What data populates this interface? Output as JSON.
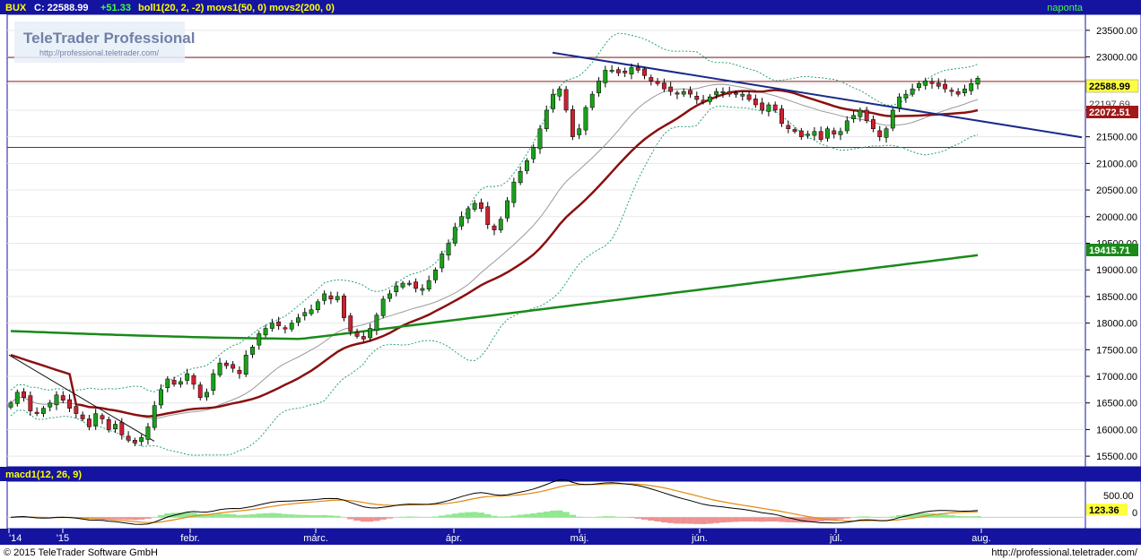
{
  "header": {
    "symbol": "BUX",
    "close_label": "C: 22588.99",
    "change": "+51.33",
    "indicators": "boll1(20, 2, -2)  movs1(50, 0)  movs2(200, 0)",
    "period": "naponta"
  },
  "logo": {
    "brand": "TeleTrader Professional",
    "url": "http://professional.teletrader.com/"
  },
  "macd_panel": {
    "title": "macd1(12, 26, 9)",
    "current_value": "123.36",
    "ticks": [
      "500.00",
      "0"
    ]
  },
  "footer": {
    "copyright": "© 2015 TeleTrader Software GmbH",
    "url": "http://professional.teletrader.com/"
  },
  "price_labels": {
    "close": "22588.99",
    "boll_upper_partial": "22197.69",
    "ma50": "22072.51",
    "ma200": "19415.71"
  },
  "colors": {
    "background": "#ffffff",
    "header_bar": "#1414a0",
    "grid": "#e8e8e8",
    "candle_up": "#1aa01a",
    "candle_down": "#cc2030",
    "ma50": "#8b1010",
    "ma200": "#1a8a1a",
    "bollinger": "#28a078",
    "boll_mid": "#9a9a9a",
    "trend_blue": "#1a2a8a",
    "hline": "#8b2020",
    "macd": "#000000",
    "signal": "#e08a10"
  },
  "chart_data": {
    "type": "candlestick",
    "title": "BUX",
    "ylim": [
      15300,
      23800
    ],
    "y_ticks": [
      "15500.00",
      "16000.00",
      "16500.00",
      "17000.00",
      "17500.00",
      "18000.00",
      "18500.00",
      "19000.00",
      "19500.00",
      "20000.00",
      "20500.00",
      "21000.00",
      "21500.00",
      "22000.00",
      "22500.00",
      "23000.00",
      "23500.00"
    ],
    "x_ticks": [
      "'14",
      "'15",
      "febr.",
      "márc.",
      "ápr.",
      "máj.",
      "jún.",
      "júl.",
      "aug."
    ],
    "horizontal_lines": [
      22990,
      22540,
      21300
    ],
    "close_series": [
      16500,
      16700,
      16600,
      16350,
      16300,
      16400,
      16500,
      16650,
      16550,
      16400,
      16300,
      16200,
      16050,
      16300,
      16200,
      16000,
      16100,
      15900,
      15800,
      15750,
      15850,
      16050,
      16450,
      16750,
      16950,
      16850,
      16900,
      17050,
      16850,
      16600,
      16700,
      17050,
      17250,
      17200,
      17150,
      17050,
      17400,
      17550,
      17800,
      17900,
      18000,
      17950,
      17900,
      18000,
      18100,
      18200,
      18250,
      18400,
      18550,
      18450,
      18500,
      18100,
      17850,
      17750,
      17700,
      17900,
      18150,
      18450,
      18550,
      18700,
      18750,
      18750,
      18650,
      18650,
      18800,
      19000,
      19300,
      19500,
      19800,
      20000,
      20150,
      20250,
      20150,
      19850,
      19750,
      19950,
      20300,
      20650,
      20850,
      21050,
      21300,
      21650,
      22000,
      22300,
      22400,
      22000,
      21500,
      21650,
      22050,
      22300,
      22550,
      22750,
      22750,
      22700,
      22700,
      22800,
      22750,
      22650,
      22550,
      22500,
      22400,
      22350,
      22300,
      22350,
      22300,
      22200,
      22150,
      22250,
      22350,
      22350,
      22300,
      22300,
      22300,
      22200,
      22100,
      22000,
      22100,
      22000,
      21750,
      21650,
      21600,
      21500,
      21550,
      21600,
      21450,
      21650,
      21550,
      21600,
      21800,
      21900,
      22000,
      21800,
      21650,
      21500,
      21650,
      22000,
      22250,
      22300,
      22400,
      22500,
      22550,
      22500,
      22450,
      22400,
      22350,
      22300,
      22400,
      22500,
      22600
    ]
  }
}
